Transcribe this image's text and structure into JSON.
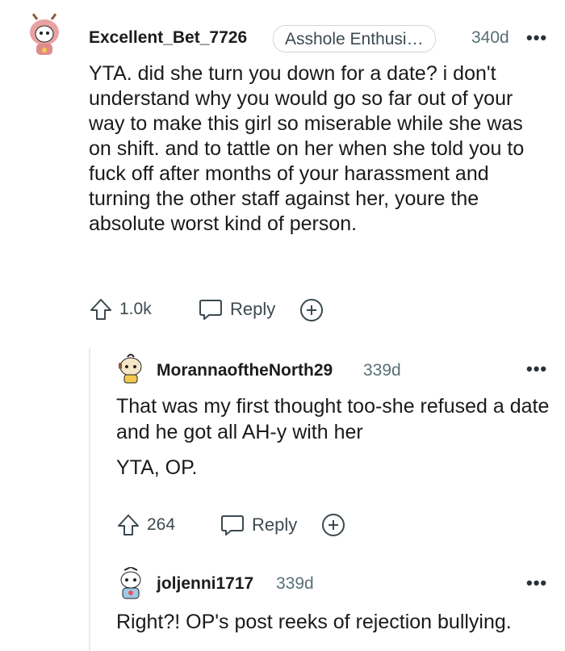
{
  "comments": [
    {
      "username": "Excellent_Bet_7726",
      "flair": "Asshole Enthusi…",
      "age": "340d",
      "more": "•••",
      "paragraphs": [
        "YTA. did she turn you down for a date? i don't understand why you would go so far out of your way to make this girl so miserable while she was on shift. and to tattle on her when she told you to fuck off after months of your harassment and turning the other staff against her, youre the absolute worst kind of person."
      ],
      "votes": "1.0k",
      "reply_label": "Reply"
    },
    {
      "username": "MorannaoftheNorth29",
      "age": "339d",
      "more": "•••",
      "paragraphs": [
        "That was my first thought too-she refused a date and he got all AH-y with her",
        "YTA, OP."
      ],
      "votes": "264",
      "reply_label": "Reply"
    },
    {
      "username": "joljenni1717",
      "age": "339d",
      "more": "•••",
      "paragraphs": [
        "Right?! OP's post reeks of rejection bullying."
      ]
    }
  ],
  "icons": {
    "upvote": "upvote-arrow-icon",
    "reply": "speech-bubble-icon",
    "award": "plus-circle-icon",
    "more": "ellipsis-icon"
  },
  "colors": {
    "text": "#1a1a1b",
    "meta": "#576f76",
    "action": "#3c4a50",
    "thread_line": "#e8ecee"
  }
}
